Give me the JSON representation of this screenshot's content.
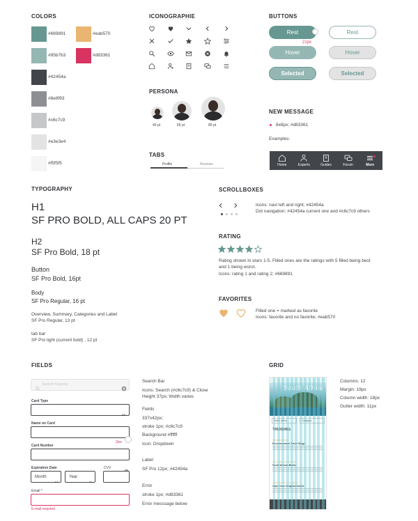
{
  "colors": {
    "title": "COLORS",
    "swatches": [
      {
        "hex": "#669891",
        "label": "#669891"
      },
      {
        "hex": "#eab570",
        "label": "#eab570"
      },
      {
        "hex": "#95b7b3",
        "label": "#95b7b3"
      },
      {
        "hex": "#d83361",
        "label": "#d83361"
      },
      {
        "hex": "#42454a",
        "label": "#42454a"
      },
      {
        "hex": "#8e8f93",
        "label": "#8e8f93"
      },
      {
        "hex": "#c6c7c9",
        "label": "#c6c7c9"
      },
      {
        "hex": "#e3e3e4",
        "label": "#e3e3e4"
      },
      {
        "hex": "#f5f5f5",
        "label": "#f5f5f5"
      }
    ]
  },
  "iconography": {
    "title": "ICONOGRAPHIE",
    "icons": [
      "heart-outline-icon",
      "heart-filled-icon",
      "chevron-down-icon",
      "chevron-left-icon",
      "chevron-right-icon",
      "close-icon",
      "checkmark-icon",
      "star-filled-icon",
      "star-outline-icon",
      "sliders-icon",
      "search-icon",
      "eye-icon",
      "mail-icon",
      "clear-circle-icon",
      "bell-icon",
      "home-icon",
      "add-user-icon",
      "book-icon",
      "chat-icon",
      "menu-icon"
    ]
  },
  "persona": {
    "title": "PERSONA",
    "sizes": [
      "40 pt",
      "65 pt",
      "80 pt"
    ]
  },
  "tabs": {
    "title": "TABS",
    "items": [
      "Profile",
      "Reviews"
    ]
  },
  "buttons": {
    "title": "BUTTONS",
    "rest": "Rest",
    "hover": "Hover",
    "selected": "Selected",
    "annotation": "21px"
  },
  "new_message": {
    "title": "NEW MESSAGE",
    "spec": "8x8px; #d83361",
    "examples": "Examples:",
    "tabbar": [
      "Home",
      "Experts",
      "Guides",
      "Forum",
      "More"
    ]
  },
  "typography": {
    "title": "TYPOGRAPHY",
    "h1_label": "H1",
    "h1_spec": "SF PRO BOLD, ALL CAPS 20 PT",
    "h2_label": "H2",
    "h2_spec": "SF Pro Bold, 18 pt",
    "button_label": "Button",
    "button_spec": "SF Pro Bold, 16pt",
    "body_label": "Body",
    "body_spec": "SF Pro Regular, 16 pt",
    "overview_label": "Overview, Summary, Categories and Label",
    "overview_spec": "SF Pro Regular, 13 pt",
    "tabbar_label": "tab bar",
    "tabbar_spec": "SF Pro light (current bold)  , 12 pt"
  },
  "scrollboxes": {
    "title": "SCROLLBOXES",
    "line1": "Icons: navi left and right; #42454a",
    "line2": "Dot navigation: #42454a current one and #c6c7c9 others"
  },
  "rating": {
    "title": "RATING",
    "value": 4,
    "max": 5,
    "line1": "Rating shown in stars 1-5. Filled ones are the ratings with 5 filled being best",
    "line2": "and 1 being worst.",
    "line3": "Icons: rating 1 and rating 2; #669891"
  },
  "favorites": {
    "title": "FAVORITES",
    "line1": "Filled one = marked as favorite",
    "line2": "Icons: favorite and no favorite; #eab570"
  },
  "fields": {
    "title": "FIELDS",
    "search_placeholder": "Search Experts",
    "card_type": "Card Type",
    "name_on_card": "Name on Card",
    "card_number": "Card Number",
    "expiration": "Expiration Date",
    "month": "Month",
    "year": "Year",
    "cvv": "CVV",
    "email": "Email *",
    "error": "E-mail required",
    "annotation": "2px",
    "spec_search_title": "Search Bar",
    "spec_search_1": "Icons: Search (#c6c7c9) & Close",
    "spec_search_2": "Height 37px; Width varies",
    "spec_fields_title": "Fields",
    "spec_fields_1": "337x42px;",
    "spec_fields_2": "stroke 1px; #c6c7c9",
    "spec_fields_3": "Background #ffffff",
    "spec_fields_4": "Icon: Dropdown",
    "spec_label_title": "Label",
    "spec_label_1": "SF Pro 12px; #42454a",
    "spec_error_title": "Error",
    "spec_error_1": "stroke 1px; #d83361",
    "spec_error_2": "Error messsage below"
  },
  "grid": {
    "title": "GRID",
    "columns": "Columns: 12",
    "margin": "Margin: 19px",
    "column_width": "Column width: 18px",
    "gutter": "Gutter width: 11px",
    "phone": {
      "hero_text": "South Africa",
      "filter1": "South Africa",
      "filter2": "Category",
      "trending": "TRENDING",
      "items": [
        {
          "tag": "INTRODUCTION",
          "title": "Recommended Travel Blogs"
        },
        {
          "tag": "CULTURE & TRADITION",
          "title": "South African Banks"
        },
        {
          "tag": "LIVING IN SOUTH AFRICA",
          "title": "Cape Town Neighborhoods"
        }
      ]
    }
  }
}
